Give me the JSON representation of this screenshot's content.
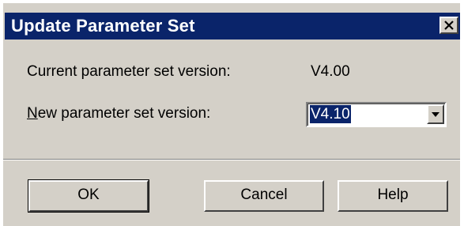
{
  "dialog": {
    "title": "Update Parameter Set",
    "close_icon": "close-icon"
  },
  "current_version": {
    "label": "Current parameter set version:",
    "value": "V4.00"
  },
  "new_version": {
    "label_mnemonic": "N",
    "label_rest": "ew parameter set version:",
    "selected_value": "V4.10",
    "dropdown_icon": "chevron-down-icon"
  },
  "buttons": {
    "ok": "OK",
    "cancel": "Cancel",
    "help": "Help"
  },
  "colors": {
    "titlebar": "#0a246a",
    "face": "#d4d0c8",
    "selection": "#0a246a"
  }
}
